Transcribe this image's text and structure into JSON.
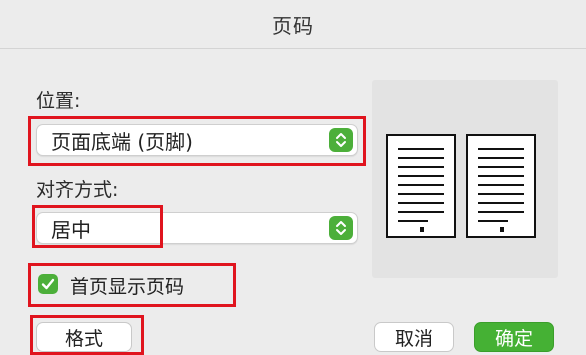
{
  "dialog": {
    "title": "页码",
    "position_label": "位置:",
    "position_value": "页面底端 (页脚)",
    "align_label": "对齐方式:",
    "align_value": "居中",
    "show_on_first_page_label": "首页显示页码",
    "show_on_first_page_checked": true,
    "format_button": "格式",
    "cancel_button": "取消",
    "ok_button": "确定"
  },
  "colors": {
    "accent_green": "#4caf3a",
    "highlight_red": "#e0141e"
  }
}
